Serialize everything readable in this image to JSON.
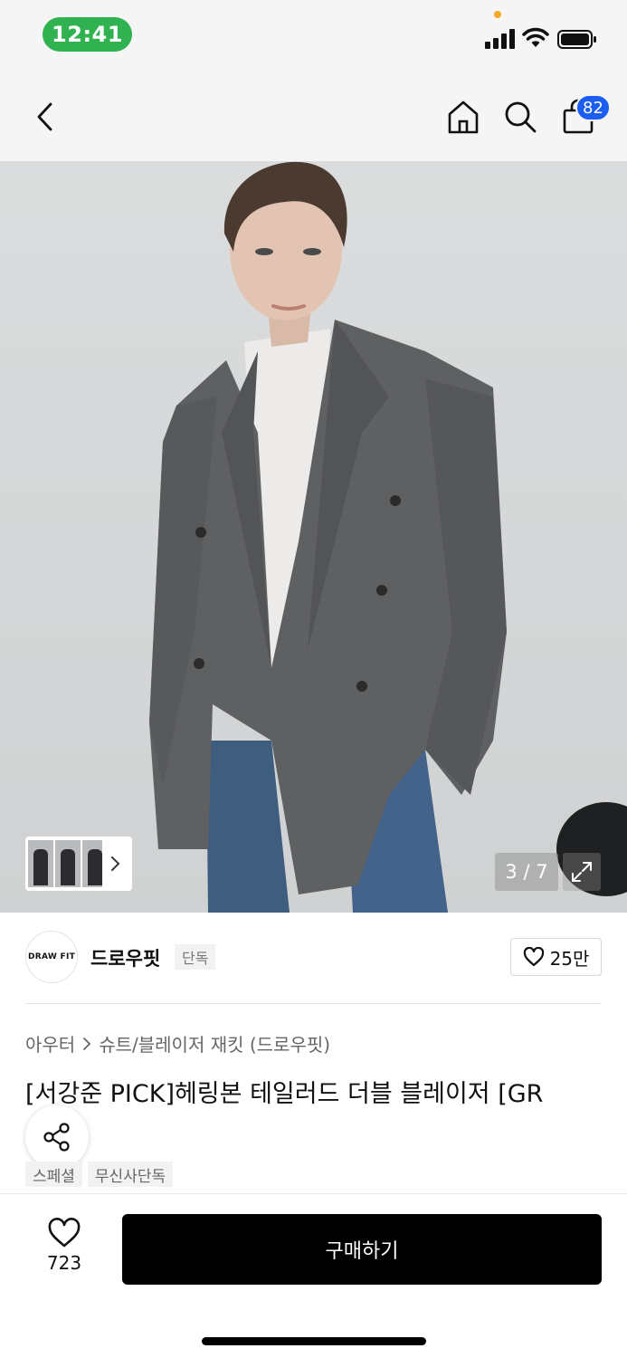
{
  "status_bar": {
    "time": "12:41",
    "icons": [
      "cellular-signal-icon",
      "wifi-icon",
      "battery-icon"
    ]
  },
  "nav": {
    "icons": [
      "back-chevron-icon",
      "home-icon",
      "search-icon",
      "shopping-bag-icon"
    ],
    "cart_count": "82"
  },
  "gallery": {
    "counter": "3 / 7",
    "icons": [
      "chevron-right-icon",
      "expand-icon"
    ]
  },
  "brand": {
    "logo_text": "DRAW FIT",
    "name": "드로우핏",
    "badge": "단독",
    "like_count": "25만"
  },
  "breadcrumb": {
    "items": [
      "아우터",
      "슈트/블레이저 재킷 (드로우핏)"
    ]
  },
  "product": {
    "title": "[서강준 PICK]헤링본 테일러드 더블 블레이저 [GR",
    "tags": [
      "스페셜",
      "무신사단독"
    ]
  },
  "bottom_bar": {
    "wish_count": "723",
    "buy_label": "구매하기"
  },
  "colors": {
    "status_green": "#2fb24f",
    "badge_blue": "#1c5df2",
    "buy_button": "#000000"
  }
}
